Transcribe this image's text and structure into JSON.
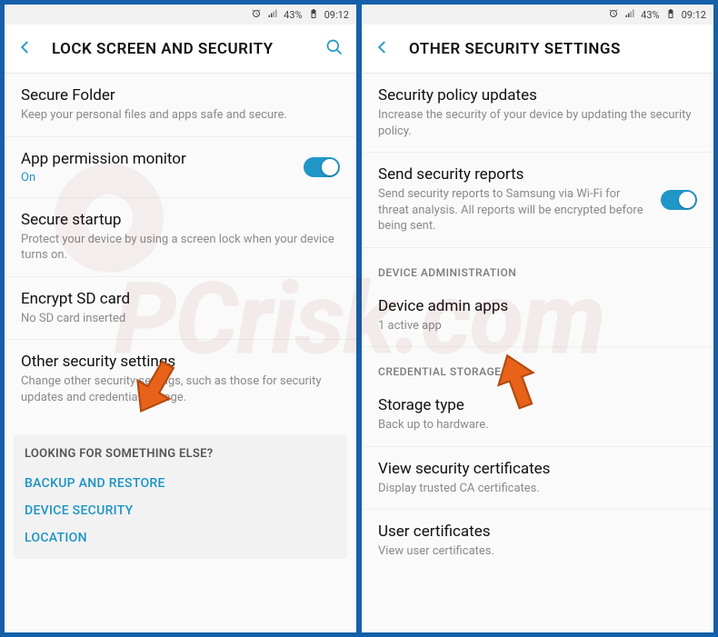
{
  "status": {
    "battery_pct": "43%",
    "time": "09:12"
  },
  "left": {
    "title": "LOCK SCREEN AND SECURITY",
    "items": [
      {
        "primary": "Secure Folder",
        "secondary": "Keep your personal files and apps safe and secure."
      },
      {
        "primary": "App permission monitor",
        "status": "On",
        "toggle": true
      },
      {
        "primary": "Secure startup",
        "secondary": "Protect your device by using a screen lock when your device turns on."
      },
      {
        "primary": "Encrypt SD card",
        "secondary": "No SD card inserted"
      },
      {
        "primary": "Other security settings",
        "secondary": "Change other security settings, such as those for security updates and credential storage."
      }
    ],
    "footer": {
      "title": "LOOKING FOR SOMETHING ELSE?",
      "links": [
        "BACKUP AND RESTORE",
        "DEVICE SECURITY",
        "LOCATION"
      ]
    }
  },
  "right": {
    "title": "OTHER SECURITY SETTINGS",
    "items": [
      {
        "primary": "Security policy updates",
        "secondary": "Increase the security of your device by updating the security policy."
      },
      {
        "primary": "Send security reports",
        "secondary": "Send security reports to Samsung via Wi-Fi for threat analysis. All reports will be encrypted before being sent.",
        "toggle": true
      }
    ],
    "section1": "DEVICE ADMINISTRATION",
    "admin": {
      "primary": "Device admin apps",
      "secondary": "1 active app"
    },
    "section2": "CREDENTIAL STORAGE",
    "cred": [
      {
        "primary": "Storage type",
        "secondary": "Back up to hardware."
      },
      {
        "primary": "View security certificates",
        "secondary": "Display trusted CA certificates."
      },
      {
        "primary": "User certificates",
        "secondary": "View user certificates."
      }
    ]
  }
}
